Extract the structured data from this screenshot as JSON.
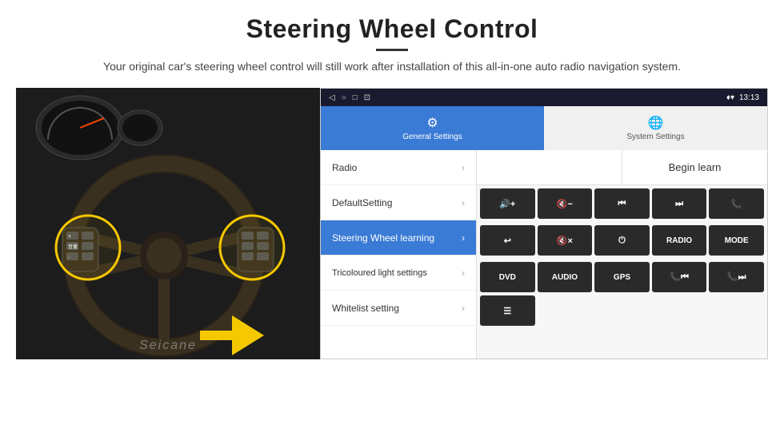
{
  "page": {
    "title": "Steering Wheel Control",
    "subtitle": "Your original car's steering wheel control will still work after installation of this all-in-one auto radio navigation system."
  },
  "status_bar": {
    "icons": [
      "◁",
      "○",
      "□",
      "⊡"
    ],
    "right_icons": "♦ ▾",
    "time": "13:13"
  },
  "tabs": [
    {
      "id": "general",
      "label": "General Settings",
      "active": true,
      "icon": "⚙"
    },
    {
      "id": "system",
      "label": "System Settings",
      "active": false,
      "icon": "🌐"
    }
  ],
  "menu_items": [
    {
      "id": "radio",
      "label": "Radio",
      "active": false
    },
    {
      "id": "default",
      "label": "DefaultSetting",
      "active": false
    },
    {
      "id": "steering",
      "label": "Steering Wheel learning",
      "active": true
    },
    {
      "id": "tricoloured",
      "label": "Tricoloured light settings",
      "active": false
    },
    {
      "id": "whitelist",
      "label": "Whitelist setting",
      "active": false
    }
  ],
  "right_panel": {
    "begin_learn_label": "Begin learn",
    "control_buttons_row1": [
      {
        "id": "vol-up",
        "label": "🔊+",
        "symbol": "🔊+"
      },
      {
        "id": "vol-down",
        "label": "🔇-",
        "symbol": "🔇-"
      },
      {
        "id": "prev",
        "label": "⏮",
        "symbol": "⏮"
      },
      {
        "id": "next",
        "label": "⏭",
        "symbol": "⏭"
      },
      {
        "id": "phone",
        "label": "📞",
        "symbol": "📞"
      }
    ],
    "control_buttons_row2": [
      {
        "id": "hangup",
        "label": "↩",
        "symbol": "↩"
      },
      {
        "id": "mute",
        "label": "🔇×",
        "symbol": "🔇×"
      },
      {
        "id": "power",
        "label": "⏻",
        "symbol": "⏻"
      },
      {
        "id": "radio-btn",
        "label": "RADIO",
        "symbol": "RADIO"
      },
      {
        "id": "mode",
        "label": "MODE",
        "symbol": "MODE"
      }
    ],
    "control_buttons_row3": [
      {
        "id": "dvd",
        "label": "DVD",
        "symbol": "DVD"
      },
      {
        "id": "audio",
        "label": "AUDIO",
        "symbol": "AUDIO"
      },
      {
        "id": "gps",
        "label": "GPS",
        "symbol": "GPS"
      },
      {
        "id": "tel-prev",
        "label": "📞⏮",
        "symbol": "📞⏮"
      },
      {
        "id": "tel-next",
        "label": "📞⏭",
        "symbol": "📞⏭"
      }
    ],
    "control_buttons_row4": [
      {
        "id": "menu-icon",
        "label": "☰",
        "symbol": "☰"
      }
    ]
  },
  "watermark": "Seicane"
}
